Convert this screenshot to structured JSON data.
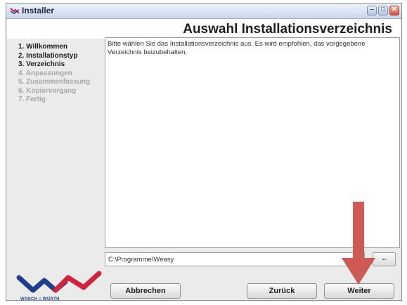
{
  "window": {
    "title": "Installer",
    "page_title": "Auswahl Installationsverzeichnis"
  },
  "steps": [
    {
      "label": "1. Willkommen",
      "state": "done"
    },
    {
      "label": "2. Installationstyp",
      "state": "done"
    },
    {
      "label": "3. Verzeichnis",
      "state": "current"
    },
    {
      "label": "4. Anpassungen",
      "state": "pending"
    },
    {
      "label": "5. Zusammenfassung",
      "state": "pending"
    },
    {
      "label": "6. Kopiervorgang",
      "state": "pending"
    },
    {
      "label": "7. Fertig",
      "state": "pending"
    }
  ],
  "content": {
    "description": "Bitte wählen Sie das Installationsverzeichnis aus. Es wird empfohlen, das vorgegebene Verzeichnis beizubehalten."
  },
  "path": {
    "value": "C:\\Programme\\Weasy",
    "browse_label": ".."
  },
  "buttons": {
    "cancel": "Abbrechen",
    "back": "Zurück",
    "next": "Weiter"
  },
  "logo": {
    "text": "WANCH ≡ WÜRTH"
  },
  "colors": {
    "arrow": "#cd5a55",
    "titlebar_top": "#eef3fb",
    "titlebar_bottom": "#c9d7ec",
    "logo_blue": "#1d3f8c",
    "logo_red": "#d2233c"
  },
  "icons": [
    "installer-app-icon",
    "minimize-icon",
    "maximize-icon",
    "close-icon",
    "annotation-arrow"
  ]
}
